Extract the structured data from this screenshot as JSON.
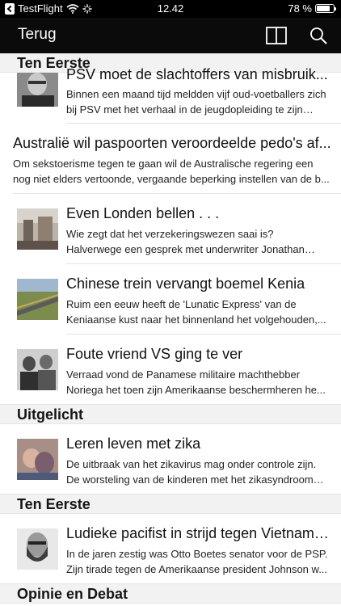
{
  "status_bar": {
    "back_app": "TestFlight",
    "time": "12.42",
    "battery": "78 %",
    "battery_level": 0.78
  },
  "nav": {
    "back_label": "Terug",
    "layout_icon": "columns-icon",
    "search_icon": "search-icon"
  },
  "sections": [
    {
      "header": "Ten Eerste",
      "articles": [
        {
          "title": "PSV moet de slachtoffers van misbruik...",
          "summary": "Binnen een maand tijd meldden vijf oud-voetballers zich bij PSV met het verhaal in de jeugdopleiding te zijn mis..."
        },
        {
          "title": "Australië wil paspoorten veroordeelde pedo's af...",
          "summary": "Om sekstoerisme tegen te gaan wil de Australische regering een nog niet elders vertoonde, vergaande beperking instellen van de b..."
        },
        {
          "title": "Even Londen bellen . . .",
          "summary": "Wie zegt dat het verzekeringswezen saai is? Halverwege een gesprek met underwriter Jonathan Thomas over h..."
        },
        {
          "title": "Chinese trein vervangt boemel Kenia",
          "summary": "Ruim een eeuw heeft de 'Lunatic Express' van de Keniaanse kust naar het binnenland het volgehouden,..."
        },
        {
          "title": "Foute vriend VS ging te ver",
          "summary": "Verraad vond de Panamese militaire machthebber Noriega het toen zijn Amerikaanse beschermheren he..."
        }
      ]
    },
    {
      "header": "Uitgelicht",
      "articles": [
        {
          "title": "Leren leven met zika",
          "summary": "De uitbraak van het zikavirus mag onder controle zijn. De worsteling van de kinderen met het zikasyndroom e..."
        }
      ]
    },
    {
      "header": "Ten Eerste",
      "articles": [
        {
          "title": "Ludieke pacifist in strijd tegen Vietnamo...",
          "summary": "In de jaren zestig was Otto Boetes senator voor de PSP. Zijn tirade tegen de Amerikaanse president Johnson w..."
        }
      ]
    },
    {
      "header": "Opinie en Debat",
      "articles": []
    }
  ]
}
